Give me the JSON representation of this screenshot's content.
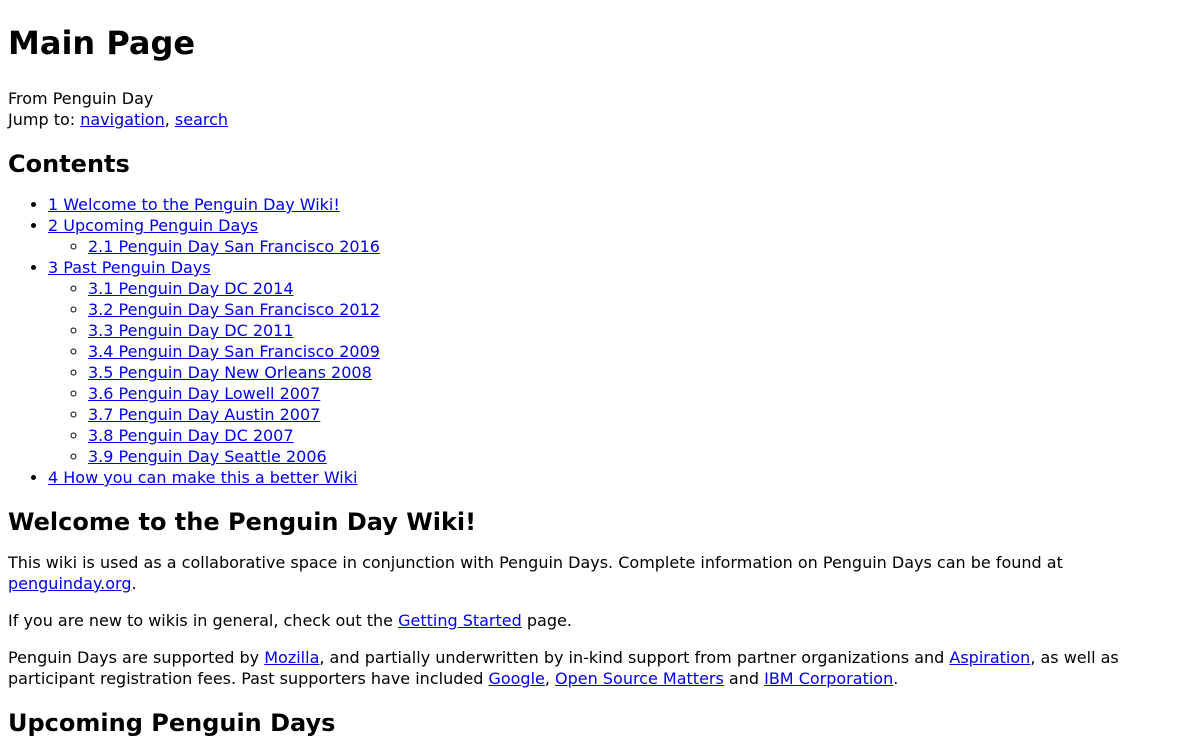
{
  "page": {
    "title": "Main Page",
    "tagline": "From Penguin Day",
    "jump_label": "Jump to:",
    "jump_navigation": "navigation",
    "jump_separator": ",",
    "jump_search": "search"
  },
  "toc": {
    "heading": "Contents",
    "items": [
      {
        "label": "1 Welcome to the Penguin Day Wiki!"
      },
      {
        "label": "2 Upcoming Penguin Days",
        "children": [
          "2.1 Penguin Day San Francisco 2016"
        ]
      },
      {
        "label": "3 Past Penguin Days",
        "children": [
          "3.1 Penguin Day DC 2014",
          "3.2 Penguin Day San Francisco 2012",
          "3.3 Penguin Day DC 2011",
          "3.4 Penguin Day San Francisco 2009",
          "3.5 Penguin Day New Orleans 2008",
          "3.6 Penguin Day Lowell 2007",
          "3.7 Penguin Day Austin 2007",
          "3.8 Penguin Day DC 2007",
          "3.9 Penguin Day Seattle 2006"
        ]
      },
      {
        "label": "4 How you can make this a better Wiki"
      }
    ]
  },
  "welcome": {
    "heading": "Welcome to the Penguin Day Wiki!",
    "p1_text": "This wiki is used as a collaborative space in conjunction with Penguin Days. Complete information on Penguin Days can be found at ",
    "p1_link": "penguinday.org",
    "p1_end": ".",
    "p2_text": "If you are new to wikis in general, check out the ",
    "p2_link": "Getting Started",
    "p2_end": " page.",
    "p3_a": "Penguin Days are supported by ",
    "p3_link_mozilla": "Mozilla",
    "p3_b": ", and partially underwritten by in-kind support from partner organizations and ",
    "p3_link_aspiration": "Aspiration",
    "p3_c": ", as well as participant registration fees. Past supporters have included ",
    "p3_link_google": "Google",
    "p3_d": ", ",
    "p3_link_osm": "Open Source Matters",
    "p3_e": " and ",
    "p3_link_ibm": "IBM Corporation",
    "p3_f": "."
  },
  "upcoming": {
    "heading": "Upcoming Penguin Days"
  }
}
